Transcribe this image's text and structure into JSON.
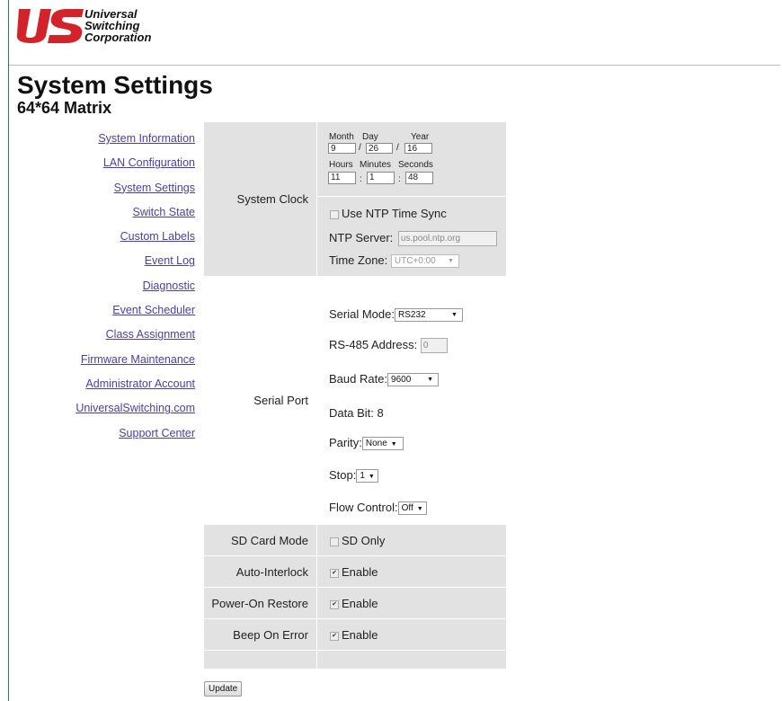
{
  "logo": {
    "mark": "US",
    "line1": "Universal",
    "line2": "Switching",
    "line3": "Corporation",
    "brand_color": "#d2232a"
  },
  "page": {
    "title": "System Settings",
    "subtitle": "64*64 Matrix"
  },
  "nav": [
    "System Information",
    "LAN Configuration",
    "System Settings",
    "Switch State",
    "Custom Labels",
    "Event Log",
    "Diagnostic",
    "Event Scheduler",
    "Class Assignment",
    "Firmware Maintenance",
    "Administrator Account",
    "UniversalSwitching.com",
    "Support Center"
  ],
  "clock": {
    "label": "System Clock",
    "month_label": "Month",
    "day_label": "Day",
    "year_label": "Year",
    "month": "9",
    "day": "26",
    "year": "16",
    "hours_label": "Hours",
    "minutes_label": "Minutes",
    "seconds_label": "Seconds",
    "hours": "11",
    "minutes": "1",
    "seconds": "48",
    "date_sep": "/",
    "time_sep": ":",
    "ntp_label": "Use NTP Time Sync",
    "ntp_server_label": "NTP Server:",
    "ntp_server": "us.pool.ntp.org",
    "tz_label": "Time Zone:",
    "tz_value": "UTC+0:00"
  },
  "serial": {
    "label": "Serial Port",
    "mode_label": "Serial Mode:",
    "mode_value": "RS232",
    "addr_label": "RS-485 Address:",
    "addr_value": "0",
    "baud_label": "Baud Rate:",
    "baud_value": "9600",
    "databit": "Data Bit: 8",
    "parity_label": "Parity:",
    "parity_value": "None",
    "stop_label": "Stop:",
    "stop_value": "1",
    "flow_label": "Flow Control:",
    "flow_value": "Off"
  },
  "options": {
    "sd_label": "SD Card Mode",
    "sd_value": "SD Only",
    "interlock_label": "Auto-Interlock",
    "interlock_value": "Enable",
    "restore_label": "Power-On Restore",
    "restore_value": "Enable",
    "beep_label": "Beep On Error",
    "beep_value": "Enable"
  },
  "update_label": "Update"
}
